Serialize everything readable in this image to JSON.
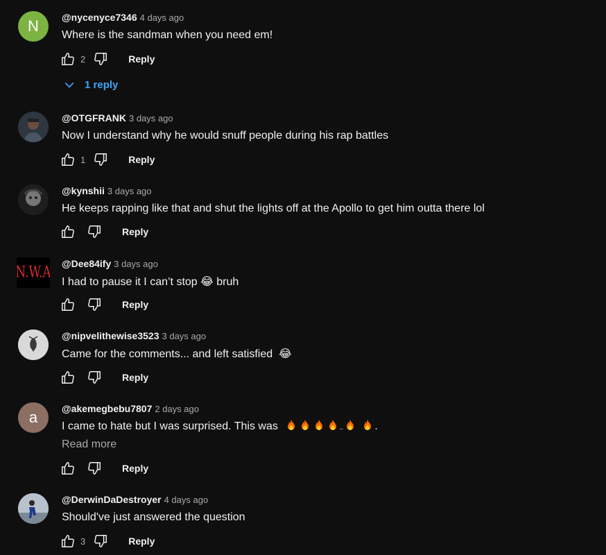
{
  "comments": [
    {
      "author": "@nycenyce7346",
      "time": "4 days ago",
      "text": "Where is the sandman when you need em!",
      "likes": "2",
      "reply_label": "Reply",
      "avatar_letter": "N",
      "avatar_color": "#7cb342",
      "replies_label": "1 reply"
    },
    {
      "author": "@OTGFRANK",
      "time": "3 days ago",
      "text": "Now I understand why he would snuff people during his rap battles",
      "likes": "1",
      "reply_label": "Reply"
    },
    {
      "author": "@kynshii",
      "time": "3 days ago",
      "text": "He keeps rapping like that and shut the lights off at the Apollo to get him outta there lol",
      "likes": "",
      "reply_label": "Reply"
    },
    {
      "author": "@Dee84ify",
      "time": "3 days ago",
      "text_before": "I had to pause it I can’t stop ",
      "emoji": "😂",
      "text_after": " bruh",
      "likes": "",
      "reply_label": "Reply",
      "avatar_text": "N.W.A"
    },
    {
      "author": "@nipvelithewise3523",
      "time": "3 days ago",
      "text_before": "Came for the comments... and left satisfied  ",
      "emoji": "😂",
      "likes": "",
      "reply_label": "Reply"
    },
    {
      "author": "@akemegbebu7807",
      "time": "2 days ago",
      "text_before": "I came to hate but I was surprised. This was ",
      "text_after": ".",
      "read_more": "Read more",
      "likes": "",
      "reply_label": "Reply",
      "avatar_letter": "a",
      "avatar_color": "#8d6e63"
    },
    {
      "author": "@DerwinDaDestroyer",
      "time": "4 days ago",
      "text": "Should've just answered the question",
      "likes": "3",
      "reply_label": "Reply"
    }
  ],
  "colors": {
    "background": "#0f0f0f",
    "text": "#f1f1f1",
    "secondary": "#aaaaaa",
    "link": "#3ea6ff"
  },
  "icons": {
    "like": "thumbs-up-icon",
    "dislike": "thumbs-down-icon",
    "expand": "chevron-down-icon",
    "fire": "fire-emoji-icon"
  }
}
